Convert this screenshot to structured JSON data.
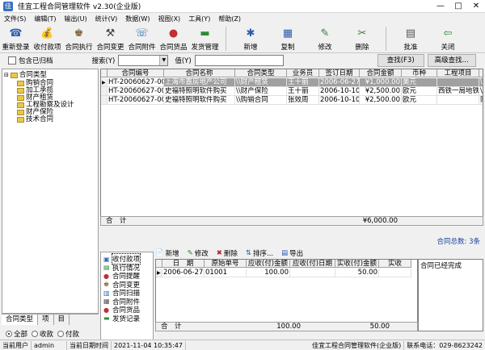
{
  "window": {
    "title": "佳宜工程合同管理软件 v2.30(企业版)",
    "min": "—",
    "max": "□",
    "close": "✕"
  },
  "menu": [
    "文件(S)",
    "编辑(T)",
    "输出(U)",
    "统计(V)",
    "数据(W)",
    "视图(X)",
    "工具(Y)",
    "帮助(Z)"
  ],
  "toolbar": [
    {
      "label": "重新登录",
      "icon": "relogin-icon",
      "glyph": "☎",
      "color": "#2B5FAF"
    },
    {
      "label": "收付款项",
      "icon": "money-bag-icon",
      "glyph": "💰",
      "color": "#333333"
    },
    {
      "label": "合同执行",
      "icon": "contract-run-icon",
      "glyph": "♚",
      "color": "#7A5A2A"
    },
    {
      "label": "合同变更",
      "icon": "contract-change-icon",
      "glyph": "⚒",
      "color": "#3A3A3A"
    },
    {
      "label": "合同附件",
      "icon": "attachment-icon",
      "glyph": "☏",
      "color": "#2A6AB0"
    },
    {
      "label": "合同货品",
      "icon": "goods-icon",
      "glyph": "●",
      "color": "#C03030"
    },
    {
      "label": "发货管理",
      "icon": "shipping-icon",
      "glyph": "▬",
      "color": "#2E8B3A"
    },
    {
      "label": "新增",
      "icon": "new-icon",
      "glyph": "✱",
      "color": "#2A5AB0"
    },
    {
      "label": "复制",
      "icon": "copy-icon",
      "glyph": "▦",
      "color": "#2A5AB0"
    },
    {
      "label": "修改",
      "icon": "edit-icon",
      "glyph": "✎",
      "color": "#3A7A3A"
    },
    {
      "label": "删除",
      "icon": "delete-icon",
      "glyph": "✂",
      "color": "#3A7A3A"
    },
    {
      "label": "批准",
      "icon": "approve-icon",
      "glyph": "▤",
      "color": "#555555"
    },
    {
      "label": "关闭",
      "icon": "close-door-icon",
      "glyph": "⇦",
      "color": "#2E8B3A"
    }
  ],
  "search": {
    "include_archived": "包含已归档",
    "search_label": "搜索(Y)",
    "value_label": "值(Y)",
    "find_button": "查找(F3)",
    "advanced_button": "高级查找..."
  },
  "tree": {
    "root": "合同类型",
    "items": [
      "购销合同",
      "加工承揽",
      "财产租赁",
      "工程勘察及设计",
      "财产保险",
      "技术合同"
    ]
  },
  "left_tabs": [
    "合同类型",
    "项",
    "目"
  ],
  "radios": {
    "all": "全部",
    "receive": "收款",
    "pay": "付款"
  },
  "grid": {
    "columns": [
      "合同编号",
      "合同名称",
      "合同类型",
      "业务员",
      "签订日期",
      "合同金额",
      "币种",
      "工程项目",
      "目"
    ],
    "rows": [
      [
        "HT-20060627-00",
        "上海市嘉房地产公司",
        "\\\\财产租赁",
        "王十丽",
        "2006-06-27",
        "¥1,000.00",
        "美元",
        "",
        "\\\\财"
      ],
      [
        "HT-20060627-00",
        "史福特照明软件购买",
        "\\\\财产保险",
        "王十丽",
        "2006-10-10",
        "¥2,500.00",
        "欧元",
        "西铁一局地铁",
        "\\\\财"
      ],
      [
        "HT-20060627-00",
        "史福特照明软件购买",
        "\\\\购销合同",
        "张效周",
        "2006-10-10",
        "¥2,500.00",
        "欧元",
        "",
        "财务"
      ]
    ],
    "total_label": "合　计",
    "total_amount": "¥6,000.00",
    "count_text": "合同总数: 3条"
  },
  "sub_list": [
    "收付款项",
    "执行情况",
    "合同提醒",
    "合同变更",
    "合同扫描",
    "合同附件",
    "合同货品",
    "发货记录"
  ],
  "sub_toolbar": [
    "新增",
    "修改",
    "删除",
    "排序...",
    "导出"
  ],
  "sub_grid": {
    "columns": [
      "日　期",
      "原始单号",
      "应收(付)金额",
      "应收(付)日期",
      "实收(付)金额",
      "实收"
    ],
    "rows": [
      [
        "2006-06-27",
        "01001",
        "100.00",
        "",
        "50.00",
        ""
      ]
    ],
    "total_label": "合　计",
    "total_due": "100.00",
    "total_paid": "50.00"
  },
  "note": "合同已经完成",
  "status": {
    "user_label": "当前用户",
    "user": "admin",
    "time_label": "当前日期时间",
    "time": "2021-11-04 10:35:47",
    "company": "佳宜工程合同管理软件(企业版)",
    "phone_label": "联系电话：",
    "phone": "029-8623242"
  }
}
